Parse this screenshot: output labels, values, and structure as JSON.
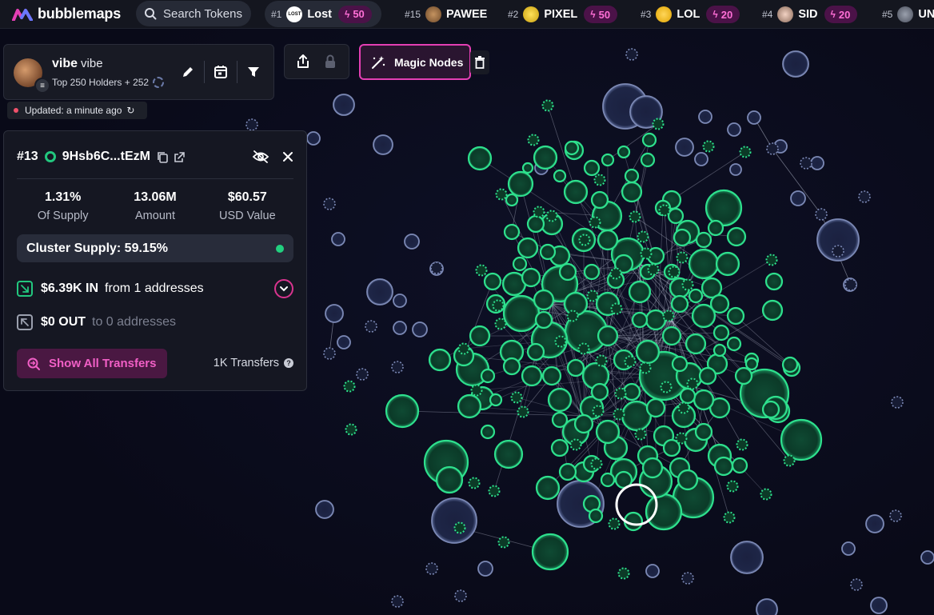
{
  "app": {
    "name": "bubblemaps",
    "accent": "#e43fb4",
    "green": "#22d07f"
  },
  "search": {
    "label": "Search Tokens",
    "icon": "search-icon"
  },
  "trending": [
    {
      "rank": "#1",
      "name": "Lost",
      "boost": "50",
      "icon_text": "LOST",
      "active": true
    },
    {
      "rank": "#15",
      "name": "PAWEE",
      "boost": "",
      "icon_text": ""
    },
    {
      "rank": "#2",
      "name": "PIXEL",
      "boost": "50",
      "icon_text": ""
    },
    {
      "rank": "#3",
      "name": "LOL",
      "boost": "20",
      "icon_text": ""
    },
    {
      "rank": "#4",
      "name": "SID",
      "boost": "20",
      "icon_text": ""
    },
    {
      "rank": "#5",
      "name": "UN",
      "boost": "",
      "icon_text": ""
    }
  ],
  "token": {
    "name": "vibe",
    "symbol": "vibe",
    "subtitle": "Top 250 Holders + 252",
    "updated": "Updated: a minute ago",
    "tools": [
      "edit-icon",
      "calendar-icon",
      "filter-icon"
    ]
  },
  "toolbar": {
    "share_icon": "share-icon",
    "lock_icon": "lock-icon",
    "magic_label": "Magic Nodes",
    "trash_icon": "trash-icon"
  },
  "details": {
    "rank": "#13",
    "address": "9Hsb6C...tEzM",
    "stats": [
      {
        "value": "1.31%",
        "label": "Of Supply"
      },
      {
        "value": "13.06M",
        "label": "Amount"
      },
      {
        "value": "$60.57",
        "label": "USD Value"
      }
    ],
    "cluster_supply": "Cluster Supply: 59.15%",
    "inflow": {
      "amount": "$6.39K IN",
      "text": "from 1 addresses"
    },
    "outflow": {
      "amount": "$0 OUT",
      "text": "to 0 addresses"
    },
    "show_all_label": "Show All Transfers",
    "transfers_count": "1K Transfers"
  }
}
